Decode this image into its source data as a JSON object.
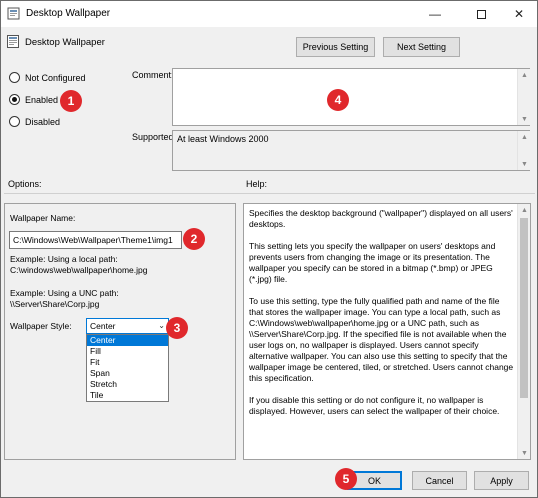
{
  "window": {
    "title": "Desktop Wallpaper"
  },
  "titlebar": {
    "minimize": "—",
    "close": "✕"
  },
  "header": {
    "title": "Desktop Wallpaper",
    "prev_label": "Previous Setting",
    "next_label": "Next Setting"
  },
  "state": {
    "options": [
      {
        "label": "Not Configured",
        "checked": false
      },
      {
        "label": "Enabled",
        "checked": true
      },
      {
        "label": "Disabled",
        "checked": false
      }
    ]
  },
  "comment": {
    "label": "Comment:",
    "value": ""
  },
  "supported": {
    "label": "Supported on:",
    "value": "At least Windows 2000"
  },
  "sections": {
    "options_label": "Options:",
    "help_label": "Help:"
  },
  "options": {
    "name_label": "Wallpaper Name:",
    "name_value": "C:\\Windows\\Web\\Wallpaper\\Theme1\\img1",
    "example_local_label": "Example: Using a local path:",
    "example_local_value": "C:\\windows\\web\\wallpaper\\home.jpg",
    "example_unc_label": "Example: Using a UNC path:",
    "example_unc_value": "\\\\Server\\Share\\Corp.jpg",
    "style_label": "Wallpaper Style:",
    "style_value": "Center",
    "style_options": [
      "Center",
      "Fill",
      "Fit",
      "Span",
      "Stretch",
      "Tile"
    ]
  },
  "help": {
    "paragraphs": [
      "Specifies the desktop background (\"wallpaper\") displayed on all users' desktops.",
      "This setting lets you specify the wallpaper on users' desktops and prevents users from changing the image or its presentation. The wallpaper you specify can be stored in a bitmap (*.bmp) or JPEG (*.jpg) file.",
      "To use this setting, type the fully qualified path and name of the file that stores the wallpaper image. You can type a local path, such as C:\\Windows\\web\\wallpaper\\home.jpg or a UNC path, such as \\\\Server\\Share\\Corp.jpg. If the specified file is not available when the user logs on, no wallpaper is displayed. Users cannot specify alternative wallpaper. You can also use this setting to specify that the wallpaper image be centered, tiled, or stretched. Users cannot change this specification.",
      "If you disable this setting or do not configure it, no wallpaper is displayed. However, users can select the wallpaper of their choice."
    ]
  },
  "footer": {
    "ok_label": "OK",
    "cancel_label": "Cancel",
    "apply_label": "Apply"
  },
  "annotations": [
    "1",
    "2",
    "3",
    "4",
    "5"
  ],
  "colors": {
    "badge": "#e0282c",
    "accent": "#0078d7"
  }
}
